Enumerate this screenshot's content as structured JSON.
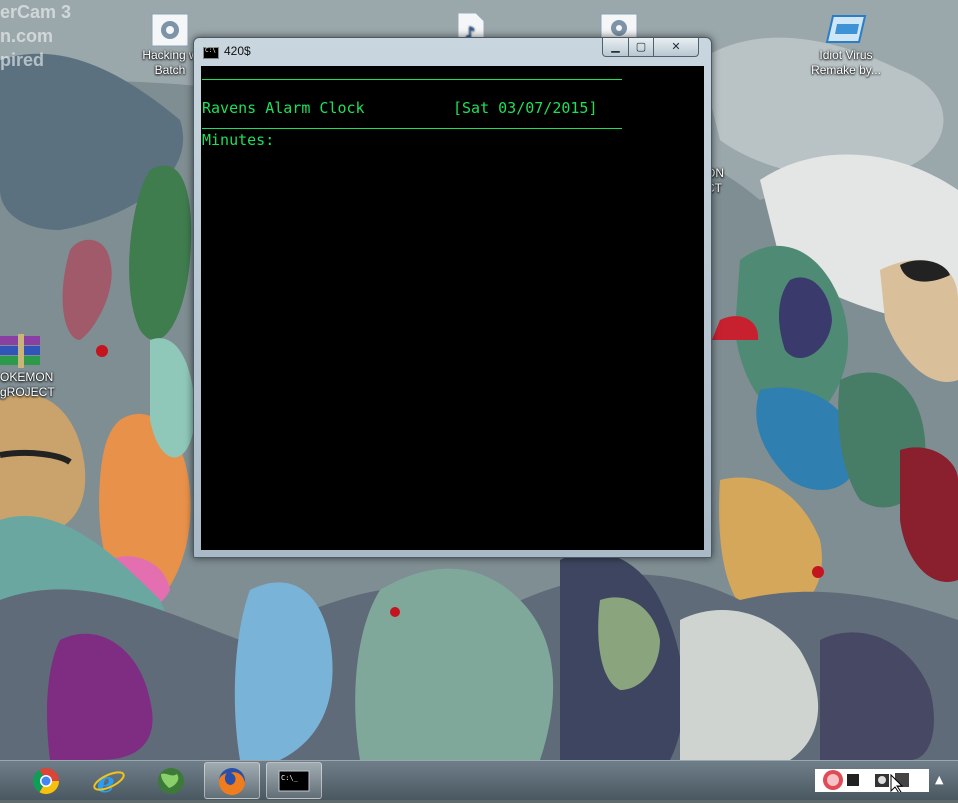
{
  "watermark": {
    "line1": "erCam 3",
    "line2": "n.com",
    "line3": "pired"
  },
  "desktop_icons": [
    {
      "label_line1": "Hacking w",
      "label_line2": "Batch",
      "icon": "batch-file-gear-icon"
    },
    {
      "label_line1": "",
      "label_line2": "",
      "icon": "music-file-icon"
    },
    {
      "label_line1": "",
      "label_line2": "",
      "icon": "batch-file-gear-icon"
    },
    {
      "label_line1": "Idiot Virus",
      "label_line2": "Remake by...",
      "icon": "application-window-icon"
    },
    {
      "label_line1": "OKEMON",
      "label_line2": "gROJECT",
      "icon": "winrar-archive-icon"
    },
    {
      "label_line1": "ON",
      "label_line2": "CT",
      "icon": "partially-hidden-icon"
    }
  ],
  "console_window": {
    "title": "420$",
    "minimize": "▁",
    "maximize": "▢",
    "close": "✕",
    "app_title": "Ravens Alarm Clock",
    "date": "[Sat 03/07/2015]",
    "prompt": "Minutes:"
  },
  "taskbar": {
    "items": [
      {
        "name": "Google Chrome",
        "icon": "chrome-icon"
      },
      {
        "name": "Internet Explorer",
        "icon": "internet-explorer-icon"
      },
      {
        "name": "Globe",
        "icon": "globe-icon"
      },
      {
        "name": "Firefox",
        "icon": "firefox-icon"
      },
      {
        "name": "Command Prompt",
        "icon": "cmd-icon"
      }
    ],
    "tray_chevron": "▲"
  },
  "colors": {
    "console_text": "#1de05a",
    "console_background": "#000000"
  }
}
